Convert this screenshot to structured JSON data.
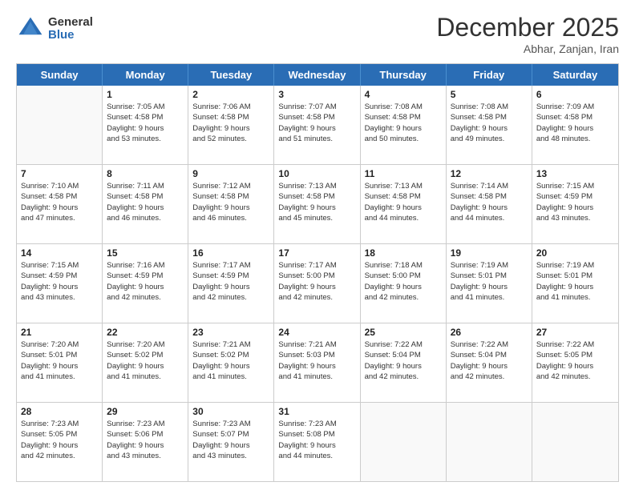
{
  "header": {
    "logo_general": "General",
    "logo_blue": "Blue",
    "month_title": "December 2025",
    "location": "Abhar, Zanjan, Iran"
  },
  "weekdays": [
    "Sunday",
    "Monday",
    "Tuesday",
    "Wednesday",
    "Thursday",
    "Friday",
    "Saturday"
  ],
  "weeks": [
    [
      {
        "day": "",
        "empty": true
      },
      {
        "day": "1",
        "sunrise": "Sunrise: 7:05 AM",
        "sunset": "Sunset: 4:58 PM",
        "daylight": "Daylight: 9 hours",
        "daylight2": "and 53 minutes."
      },
      {
        "day": "2",
        "sunrise": "Sunrise: 7:06 AM",
        "sunset": "Sunset: 4:58 PM",
        "daylight": "Daylight: 9 hours",
        "daylight2": "and 52 minutes."
      },
      {
        "day": "3",
        "sunrise": "Sunrise: 7:07 AM",
        "sunset": "Sunset: 4:58 PM",
        "daylight": "Daylight: 9 hours",
        "daylight2": "and 51 minutes."
      },
      {
        "day": "4",
        "sunrise": "Sunrise: 7:08 AM",
        "sunset": "Sunset: 4:58 PM",
        "daylight": "Daylight: 9 hours",
        "daylight2": "and 50 minutes."
      },
      {
        "day": "5",
        "sunrise": "Sunrise: 7:08 AM",
        "sunset": "Sunset: 4:58 PM",
        "daylight": "Daylight: 9 hours",
        "daylight2": "and 49 minutes."
      },
      {
        "day": "6",
        "sunrise": "Sunrise: 7:09 AM",
        "sunset": "Sunset: 4:58 PM",
        "daylight": "Daylight: 9 hours",
        "daylight2": "and 48 minutes."
      }
    ],
    [
      {
        "day": "7",
        "sunrise": "Sunrise: 7:10 AM",
        "sunset": "Sunset: 4:58 PM",
        "daylight": "Daylight: 9 hours",
        "daylight2": "and 47 minutes."
      },
      {
        "day": "8",
        "sunrise": "Sunrise: 7:11 AM",
        "sunset": "Sunset: 4:58 PM",
        "daylight": "Daylight: 9 hours",
        "daylight2": "and 46 minutes."
      },
      {
        "day": "9",
        "sunrise": "Sunrise: 7:12 AM",
        "sunset": "Sunset: 4:58 PM",
        "daylight": "Daylight: 9 hours",
        "daylight2": "and 46 minutes."
      },
      {
        "day": "10",
        "sunrise": "Sunrise: 7:13 AM",
        "sunset": "Sunset: 4:58 PM",
        "daylight": "Daylight: 9 hours",
        "daylight2": "and 45 minutes."
      },
      {
        "day": "11",
        "sunrise": "Sunrise: 7:13 AM",
        "sunset": "Sunset: 4:58 PM",
        "daylight": "Daylight: 9 hours",
        "daylight2": "and 44 minutes."
      },
      {
        "day": "12",
        "sunrise": "Sunrise: 7:14 AM",
        "sunset": "Sunset: 4:58 PM",
        "daylight": "Daylight: 9 hours",
        "daylight2": "and 44 minutes."
      },
      {
        "day": "13",
        "sunrise": "Sunrise: 7:15 AM",
        "sunset": "Sunset: 4:59 PM",
        "daylight": "Daylight: 9 hours",
        "daylight2": "and 43 minutes."
      }
    ],
    [
      {
        "day": "14",
        "sunrise": "Sunrise: 7:15 AM",
        "sunset": "Sunset: 4:59 PM",
        "daylight": "Daylight: 9 hours",
        "daylight2": "and 43 minutes."
      },
      {
        "day": "15",
        "sunrise": "Sunrise: 7:16 AM",
        "sunset": "Sunset: 4:59 PM",
        "daylight": "Daylight: 9 hours",
        "daylight2": "and 42 minutes."
      },
      {
        "day": "16",
        "sunrise": "Sunrise: 7:17 AM",
        "sunset": "Sunset: 4:59 PM",
        "daylight": "Daylight: 9 hours",
        "daylight2": "and 42 minutes."
      },
      {
        "day": "17",
        "sunrise": "Sunrise: 7:17 AM",
        "sunset": "Sunset: 5:00 PM",
        "daylight": "Daylight: 9 hours",
        "daylight2": "and 42 minutes."
      },
      {
        "day": "18",
        "sunrise": "Sunrise: 7:18 AM",
        "sunset": "Sunset: 5:00 PM",
        "daylight": "Daylight: 9 hours",
        "daylight2": "and 42 minutes."
      },
      {
        "day": "19",
        "sunrise": "Sunrise: 7:19 AM",
        "sunset": "Sunset: 5:01 PM",
        "daylight": "Daylight: 9 hours",
        "daylight2": "and 41 minutes."
      },
      {
        "day": "20",
        "sunrise": "Sunrise: 7:19 AM",
        "sunset": "Sunset: 5:01 PM",
        "daylight": "Daylight: 9 hours",
        "daylight2": "and 41 minutes."
      }
    ],
    [
      {
        "day": "21",
        "sunrise": "Sunrise: 7:20 AM",
        "sunset": "Sunset: 5:01 PM",
        "daylight": "Daylight: 9 hours",
        "daylight2": "and 41 minutes."
      },
      {
        "day": "22",
        "sunrise": "Sunrise: 7:20 AM",
        "sunset": "Sunset: 5:02 PM",
        "daylight": "Daylight: 9 hours",
        "daylight2": "and 41 minutes."
      },
      {
        "day": "23",
        "sunrise": "Sunrise: 7:21 AM",
        "sunset": "Sunset: 5:02 PM",
        "daylight": "Daylight: 9 hours",
        "daylight2": "and 41 minutes."
      },
      {
        "day": "24",
        "sunrise": "Sunrise: 7:21 AM",
        "sunset": "Sunset: 5:03 PM",
        "daylight": "Daylight: 9 hours",
        "daylight2": "and 41 minutes."
      },
      {
        "day": "25",
        "sunrise": "Sunrise: 7:22 AM",
        "sunset": "Sunset: 5:04 PM",
        "daylight": "Daylight: 9 hours",
        "daylight2": "and 42 minutes."
      },
      {
        "day": "26",
        "sunrise": "Sunrise: 7:22 AM",
        "sunset": "Sunset: 5:04 PM",
        "daylight": "Daylight: 9 hours",
        "daylight2": "and 42 minutes."
      },
      {
        "day": "27",
        "sunrise": "Sunrise: 7:22 AM",
        "sunset": "Sunset: 5:05 PM",
        "daylight": "Daylight: 9 hours",
        "daylight2": "and 42 minutes."
      }
    ],
    [
      {
        "day": "28",
        "sunrise": "Sunrise: 7:23 AM",
        "sunset": "Sunset: 5:05 PM",
        "daylight": "Daylight: 9 hours",
        "daylight2": "and 42 minutes."
      },
      {
        "day": "29",
        "sunrise": "Sunrise: 7:23 AM",
        "sunset": "Sunset: 5:06 PM",
        "daylight": "Daylight: 9 hours",
        "daylight2": "and 43 minutes."
      },
      {
        "day": "30",
        "sunrise": "Sunrise: 7:23 AM",
        "sunset": "Sunset: 5:07 PM",
        "daylight": "Daylight: 9 hours",
        "daylight2": "and 43 minutes."
      },
      {
        "day": "31",
        "sunrise": "Sunrise: 7:23 AM",
        "sunset": "Sunset: 5:08 PM",
        "daylight": "Daylight: 9 hours",
        "daylight2": "and 44 minutes."
      },
      {
        "day": "",
        "empty": true
      },
      {
        "day": "",
        "empty": true
      },
      {
        "day": "",
        "empty": true
      }
    ]
  ]
}
